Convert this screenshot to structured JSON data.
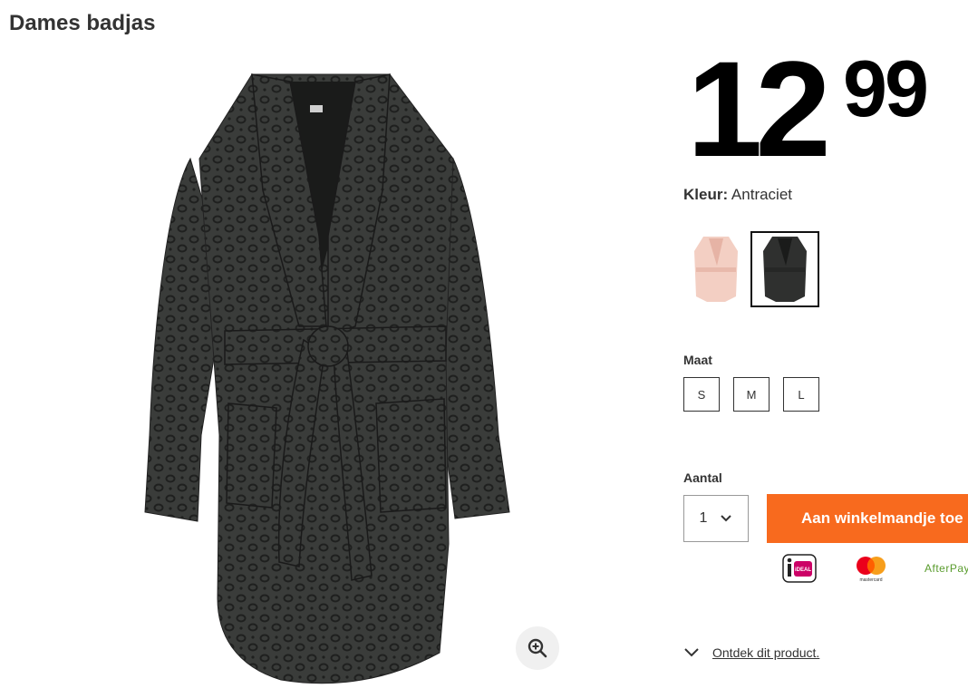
{
  "product": {
    "title": "Dames badjas"
  },
  "price": {
    "integer": "12",
    "decimals": "99"
  },
  "color": {
    "label": "Kleur:",
    "value": "Antraciet",
    "swatches": [
      {
        "name": "roze",
        "hex": "#f3cfc3",
        "selected": false
      },
      {
        "name": "antraciet",
        "hex": "#2f302f",
        "selected": true
      }
    ]
  },
  "size": {
    "label": "Maat",
    "options": [
      "S",
      "M",
      "L"
    ]
  },
  "quantity": {
    "label": "Aantal",
    "value": "1"
  },
  "cart": {
    "button_label": "Aan winkelmandje toe"
  },
  "payment": {
    "ideal": "iDEAL",
    "mastercard": "mastercard",
    "afterpay": "AfterPay"
  },
  "discover": {
    "link": "Ontdek dit product."
  },
  "colors": {
    "accent": "#f86a1e",
    "text": "#333333",
    "robe": "#2f302f",
    "robe_spot": "#1f201f"
  }
}
